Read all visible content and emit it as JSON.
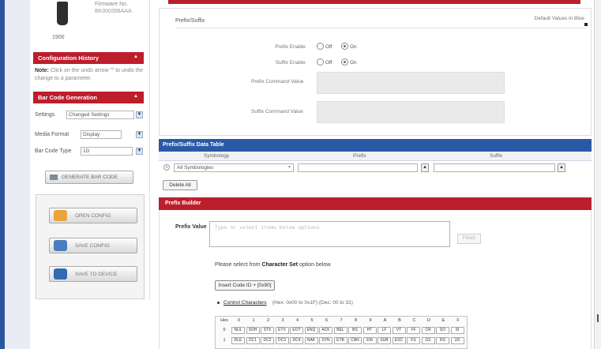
{
  "sidebar": {
    "firmware_label": "Firmware No.",
    "firmware_value": "BK000398AAA",
    "model": "1900",
    "config_history": {
      "title": "Configuration History",
      "note_label": "Note:",
      "note_text": "Click on the undo arrow \"\" to undo the change to a parameter."
    },
    "barcode_gen": {
      "title": "Bar Code Generation",
      "fields": [
        {
          "label": "Settings",
          "value": "Changed Settings"
        },
        {
          "label": "Media Format",
          "value": "Display"
        },
        {
          "label": "Bar Code Type",
          "value": "1D"
        }
      ],
      "generate_label": "GENERATE BAR CODE"
    },
    "buttons": {
      "open": "OPEN CONFIG",
      "save": "SAVE CONFIG",
      "device": "SAVE TO DEVICE"
    }
  },
  "main": {
    "section_title": "Prefix/Suffix",
    "defaults_label": "Default Values in Blue",
    "prefix_enable": {
      "label": "Prefix Enable",
      "off": "Off",
      "on": "On",
      "selected": "On"
    },
    "suffix_enable": {
      "label": "Suffix Enable",
      "off": "Off",
      "on": "On",
      "selected": "On"
    },
    "prefix_cmd_label": "Prefix Command Value",
    "suffix_cmd_label": "Suffix Command Value",
    "table": {
      "title": "Prefix/Suffix Data Table",
      "columns": [
        "Symbology",
        "Prefix",
        "Suffix"
      ],
      "row": {
        "symbology": "All Symbologies",
        "remove": "x",
        "prefix_btn": "▲",
        "suffix_btn": "▲"
      },
      "delete_all": "Delete All"
    },
    "builder": {
      "title": "Prefix Builder",
      "prefix_value_label": "Prefix Value",
      "placeholder": "Type or select items below options",
      "finish": "Finish",
      "instruction_pre": "Please select from ",
      "instruction_bold": "Character Set",
      "instruction_post": " option below.",
      "insert_code": "Insert Code ID + [0x90]",
      "control_chars": "Control Characters",
      "control_range": "(Hex: 0x00 to 0x1F) (Dec: 00 to 31)",
      "grid_header": [
        "Hex",
        "0",
        "1",
        "2",
        "3",
        "4",
        "5",
        "6",
        "7",
        "8",
        "9",
        "A",
        "B",
        "C",
        "D",
        "E",
        "F"
      ],
      "grid_rows": [
        {
          "label": "0",
          "cells": [
            "NUL",
            "SOH",
            "STX",
            "ETX",
            "EOT",
            "ENQ",
            "ACK",
            "BEL",
            "BS",
            "HT",
            "LF",
            "VT",
            "FF",
            "CR",
            "SO",
            "SI"
          ]
        },
        {
          "label": "1",
          "cells": [
            "DLE",
            "DC1",
            "DC2",
            "DC3",
            "DC4",
            "NAK",
            "SYN",
            "ETB",
            "CAN",
            "EM",
            "SUB",
            "ESC",
            "FS",
            "GS",
            "RS",
            "US"
          ]
        }
      ]
    }
  }
}
